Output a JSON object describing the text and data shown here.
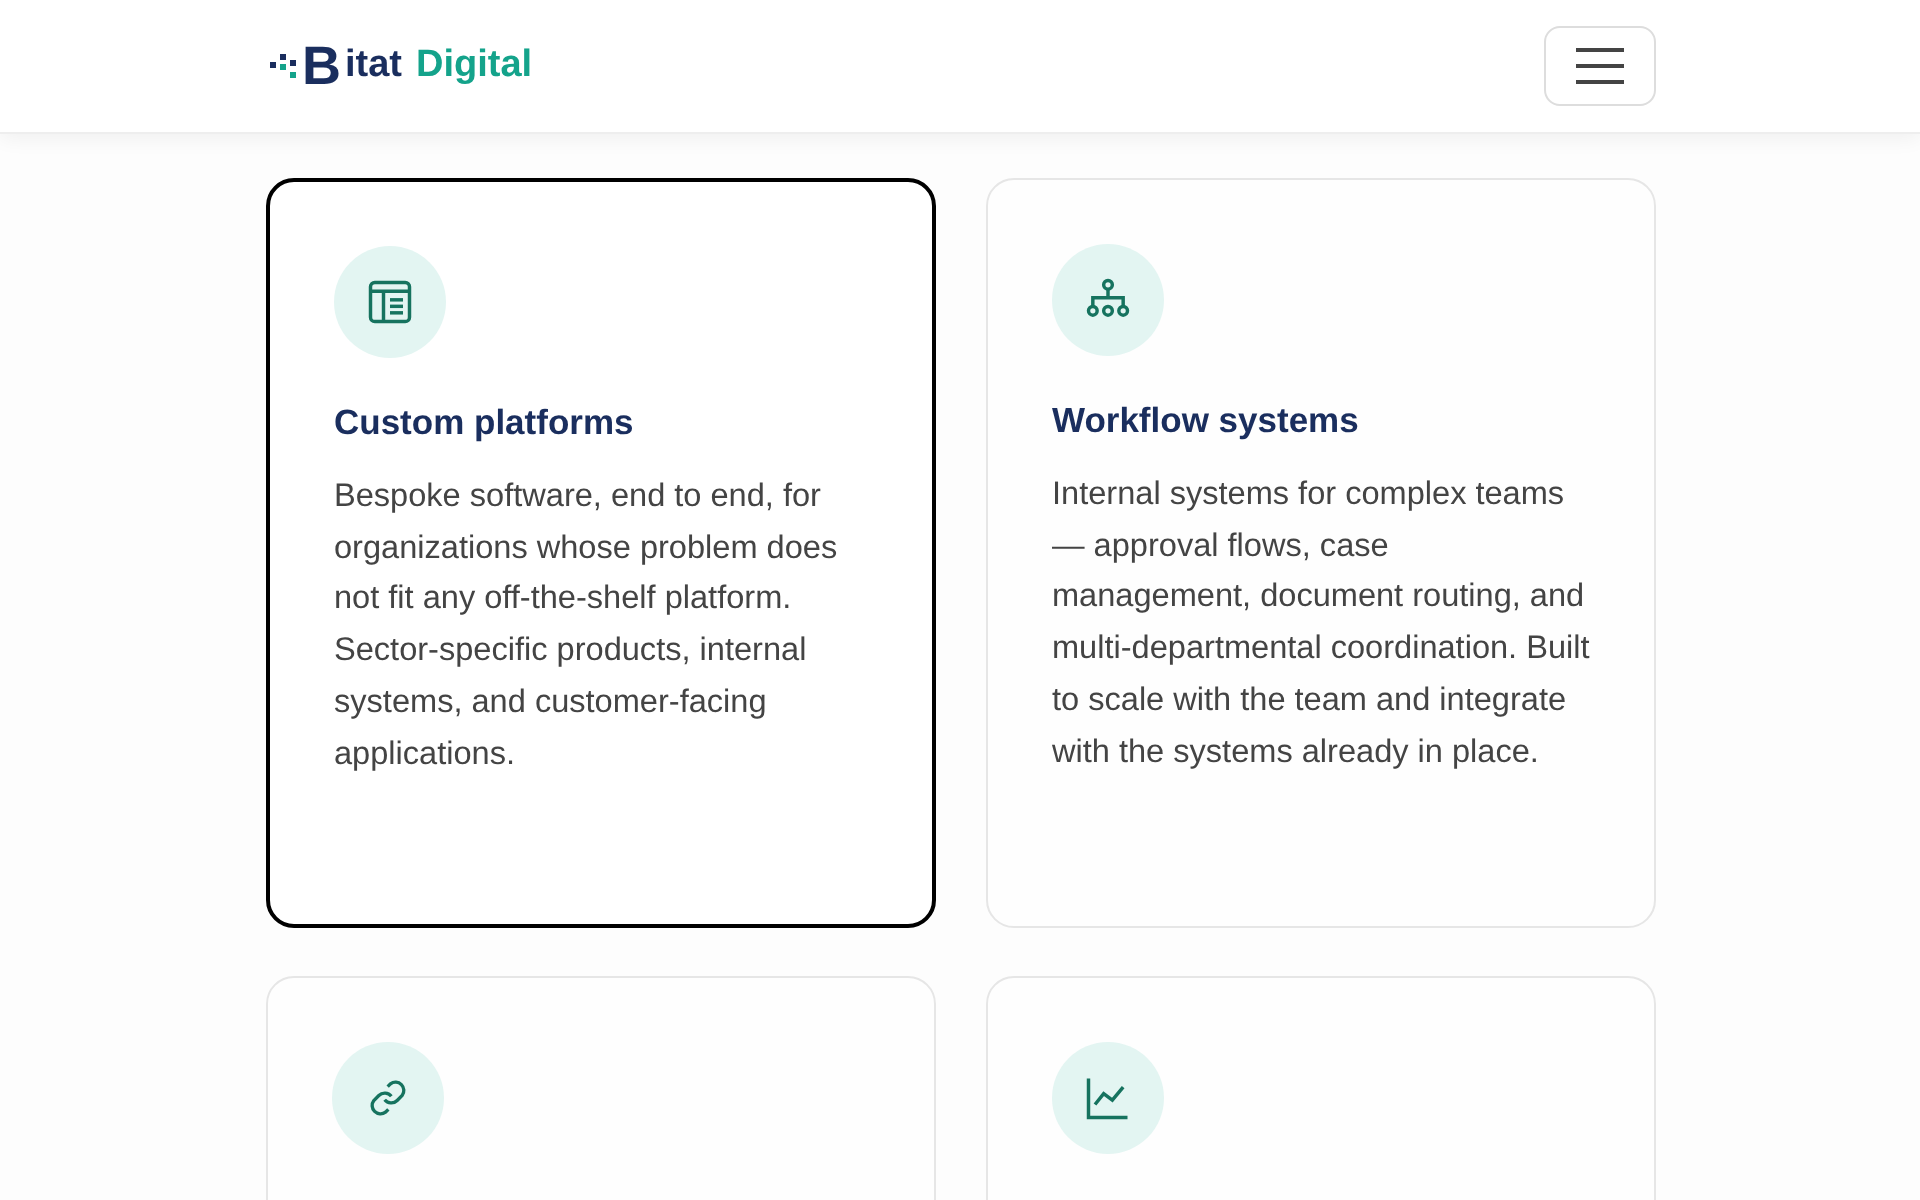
{
  "header": {
    "logo": {
      "letter": "B",
      "word1": "itat",
      "word2": "Digital"
    }
  },
  "cards": [
    {
      "title": "Custom platforms",
      "body": "Bespoke software, end to end, for organizations whose problem does not fit any off-the-shelf platform. Sector-specific products, internal systems, and customer-facing applications.",
      "focused": true
    },
    {
      "title": "Workflow systems",
      "body": "Internal systems for complex teams — approval flows, case management, document routing, and multi-departmental coordination. Built to scale with the team and integrate with the systems already in place.",
      "focused": false
    },
    {
      "focused": false
    },
    {
      "focused": false
    }
  ]
}
